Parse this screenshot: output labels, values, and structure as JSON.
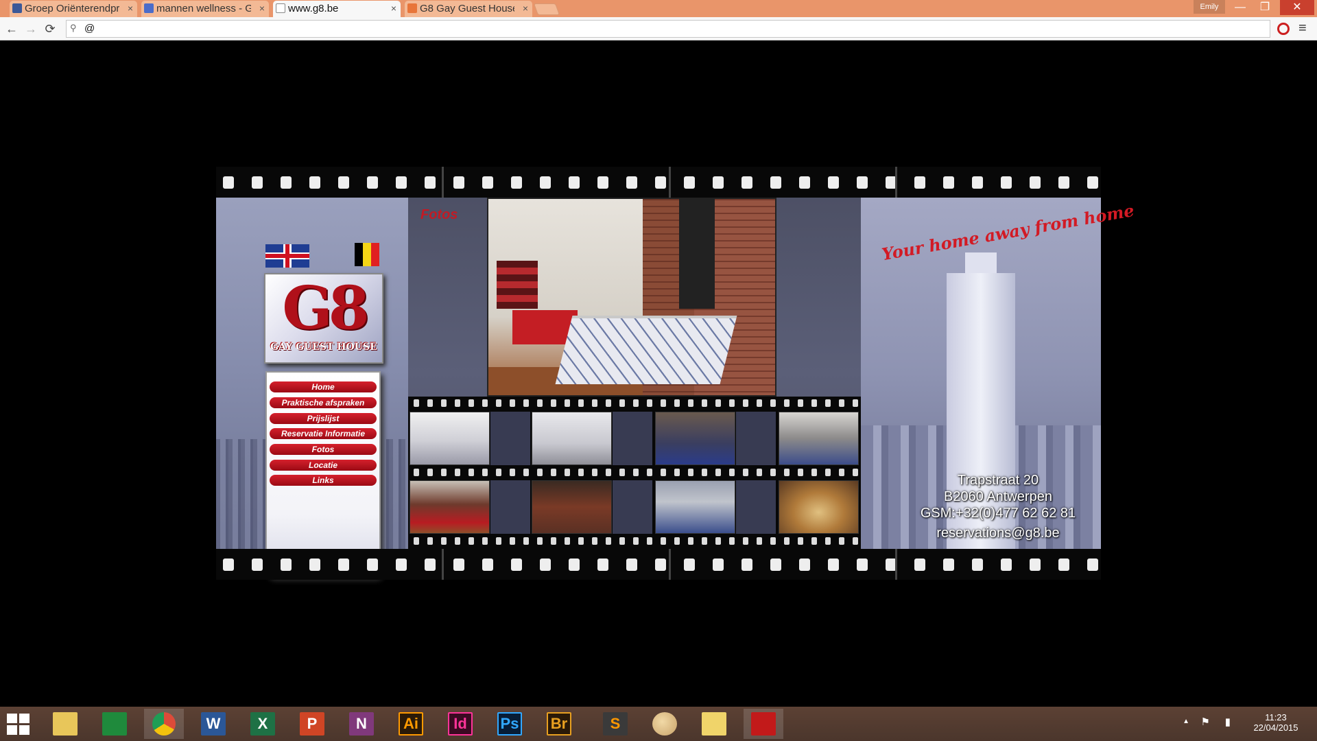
{
  "browser": {
    "tabs": [
      {
        "label": "Groep Oriënterendpr",
        "icon": "facebook-icon",
        "color": "#3b5998"
      },
      {
        "label": "mannen wellness - G",
        "icon": "g-icon",
        "color": "#4b6cc9"
      },
      {
        "label": "www.g8.be",
        "icon": "page-icon",
        "color": "#ffffff"
      },
      {
        "label": "G8 Gay Guest House",
        "icon": "chat-icon",
        "color": "#e8753a"
      }
    ],
    "close_glyph": "×",
    "user": "Emily",
    "address_value": "@",
    "search_glyph": "⚲",
    "window_controls": {
      "minimize": "—",
      "maximize": "❐",
      "close": "✕"
    },
    "nav": {
      "back": "←",
      "forward": "→",
      "reload": "⟳",
      "menu": "≡"
    }
  },
  "site": {
    "logo": {
      "main": "G8",
      "sub": "GAY GUEST HOUSE"
    },
    "nav": [
      "Home",
      "Praktische afspraken",
      "Prijslijst",
      "Reservatie Informatie",
      "Fotos",
      "Locatie",
      "Links"
    ],
    "section_title": "Fotos",
    "tagline": "Your home away from home",
    "address": {
      "street": "Trapstraat 20",
      "city": "B2060 Antwerpen",
      "phone": "GSM:+32(0)477 62 62 81",
      "email": "reservations@g8.be"
    },
    "colors": {
      "accent": "#c21a24",
      "panel": "#8a8fae"
    }
  },
  "taskbar": {
    "apps": [
      {
        "name": "file-explorer",
        "label": "",
        "color": "#e8c65a",
        "fg": "#7a5a10"
      },
      {
        "name": "store",
        "label": "",
        "color": "#1f8a3c",
        "fg": "#fff"
      },
      {
        "name": "chrome",
        "label": "",
        "color": "#dd4b39",
        "fg": "#fff"
      },
      {
        "name": "word",
        "label": "W",
        "color": "#2b5797",
        "fg": "#fff"
      },
      {
        "name": "excel",
        "label": "X",
        "color": "#1e7145",
        "fg": "#fff"
      },
      {
        "name": "powerpoint",
        "label": "P",
        "color": "#d04525",
        "fg": "#fff"
      },
      {
        "name": "onenote",
        "label": "N",
        "color": "#80397b",
        "fg": "#fff"
      },
      {
        "name": "illustrator",
        "label": "Ai",
        "color": "#2a1a08",
        "fg": "#ff9a00"
      },
      {
        "name": "indesign",
        "label": "Id",
        "color": "#3a0a22",
        "fg": "#ff3399"
      },
      {
        "name": "photoshop",
        "label": "Ps",
        "color": "#071d36",
        "fg": "#31a8ff"
      },
      {
        "name": "bridge",
        "label": "Br",
        "color": "#2a1a08",
        "fg": "#e8a020"
      },
      {
        "name": "sublime",
        "label": "S",
        "color": "#3a3a3a",
        "fg": "#ff9800"
      },
      {
        "name": "paint",
        "label": "",
        "color": "#c9a36a",
        "fg": "#fff"
      },
      {
        "name": "folder",
        "label": "",
        "color": "#f0d46a",
        "fg": "#fff"
      },
      {
        "name": "acrobat",
        "label": "",
        "color": "#c21a1a",
        "fg": "#fff"
      }
    ],
    "tray": {
      "time": "11:23",
      "date": "22/04/2015",
      "arrow": "▲",
      "flag": "⚑",
      "battery": "▮"
    }
  }
}
